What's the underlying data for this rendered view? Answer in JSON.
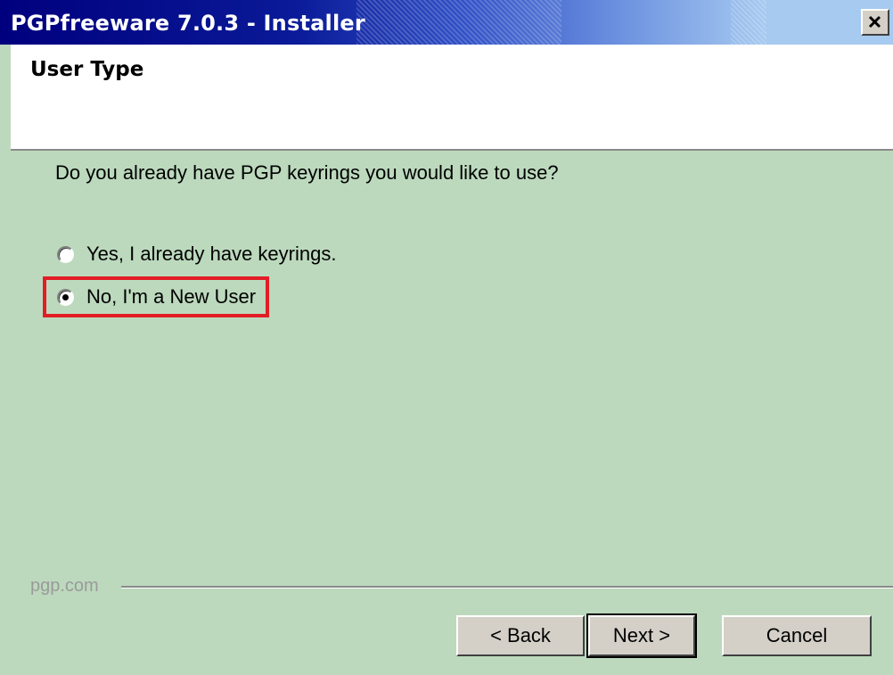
{
  "window": {
    "title": "PGPfreeware 7.0.3 - Installer",
    "close_label": "×",
    "accent": "#0a1a98",
    "background": "#bcd9bd"
  },
  "header": {
    "title": "User Type"
  },
  "main": {
    "question": "Do you already have PGP keyrings you would like to use?",
    "options": [
      {
        "label": "Yes, I already have keyrings.",
        "selected": false
      },
      {
        "label": "No, I'm a New User",
        "selected": true
      }
    ]
  },
  "footer": {
    "brand": "pgp.com",
    "back_label": "< Back",
    "next_label": "Next >",
    "cancel_label": "Cancel"
  }
}
